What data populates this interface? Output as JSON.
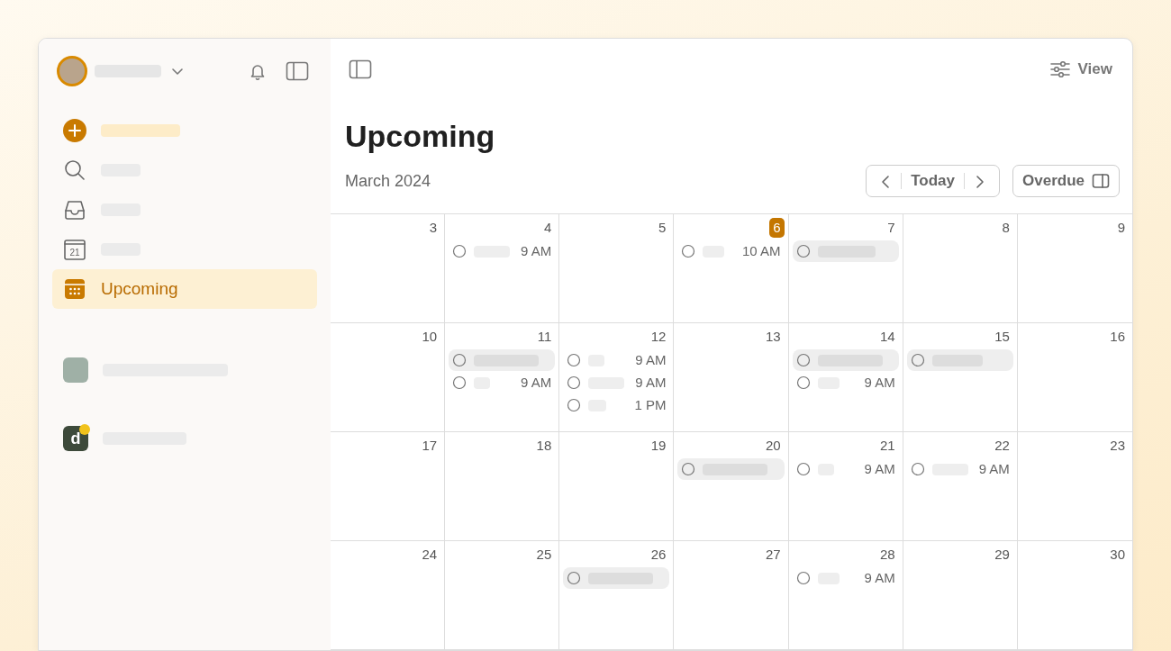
{
  "sidebar": {
    "items": [
      {
        "kind": "add",
        "selected": false
      },
      {
        "kind": "search",
        "selected": false
      },
      {
        "kind": "inbox",
        "selected": false
      },
      {
        "kind": "today",
        "selected": false,
        "icon_text": "21"
      },
      {
        "kind": "upcoming",
        "selected": true,
        "label": "Upcoming"
      }
    ],
    "projects": [
      {
        "kind": "avatar"
      },
      {
        "kind": "logo",
        "logo_text": "d"
      }
    ]
  },
  "toolbar": {
    "view_label": "View"
  },
  "header": {
    "title": "Upcoming",
    "month": "March 2024",
    "today_label": "Today",
    "overdue_label": "Overdue"
  },
  "calendar": {
    "weeks": [
      [
        {
          "day": "3",
          "today": false
        },
        {
          "day": "4",
          "today": false,
          "events": [
            {
              "kind": "timed",
              "time": "9 AM"
            }
          ]
        },
        {
          "day": "5",
          "today": false
        },
        {
          "day": "6",
          "today": true,
          "events": [
            {
              "kind": "timed",
              "time": "10 AM"
            }
          ]
        },
        {
          "day": "7",
          "today": false,
          "events": [
            {
              "kind": "all-day"
            }
          ]
        },
        {
          "day": "8",
          "today": false
        },
        {
          "day": "9",
          "today": false
        }
      ],
      [
        {
          "day": "10",
          "today": false
        },
        {
          "day": "11",
          "today": false,
          "events": [
            {
              "kind": "all-day"
            },
            {
              "kind": "timed",
              "time": "9 AM"
            }
          ]
        },
        {
          "day": "12",
          "today": false,
          "events": [
            {
              "kind": "timed",
              "time": "9 AM"
            },
            {
              "kind": "timed",
              "time": "9 AM"
            },
            {
              "kind": "timed",
              "time": "1 PM"
            }
          ]
        },
        {
          "day": "13",
          "today": false
        },
        {
          "day": "14",
          "today": false,
          "events": [
            {
              "kind": "all-day"
            },
            {
              "kind": "timed",
              "time": "9 AM"
            }
          ]
        },
        {
          "day": "15",
          "today": false,
          "events": [
            {
              "kind": "all-day"
            }
          ]
        },
        {
          "day": "16",
          "today": false
        }
      ],
      [
        {
          "day": "17",
          "today": false
        },
        {
          "day": "18",
          "today": false
        },
        {
          "day": "19",
          "today": false
        },
        {
          "day": "20",
          "today": false,
          "events": [
            {
              "kind": "all-day"
            }
          ]
        },
        {
          "day": "21",
          "today": false,
          "events": [
            {
              "kind": "timed",
              "time": "9 AM"
            }
          ]
        },
        {
          "day": "22",
          "today": false,
          "events": [
            {
              "kind": "timed",
              "time": "9 AM"
            }
          ]
        },
        {
          "day": "23",
          "today": false
        }
      ],
      [
        {
          "day": "24",
          "today": false
        },
        {
          "day": "25",
          "today": false
        },
        {
          "day": "26",
          "today": false,
          "events": [
            {
              "kind": "all-day"
            }
          ]
        },
        {
          "day": "27",
          "today": false
        },
        {
          "day": "28",
          "today": false,
          "events": [
            {
              "kind": "timed",
              "time": "9 AM"
            }
          ]
        },
        {
          "day": "29",
          "today": false
        },
        {
          "day": "30",
          "today": false
        }
      ]
    ]
  }
}
